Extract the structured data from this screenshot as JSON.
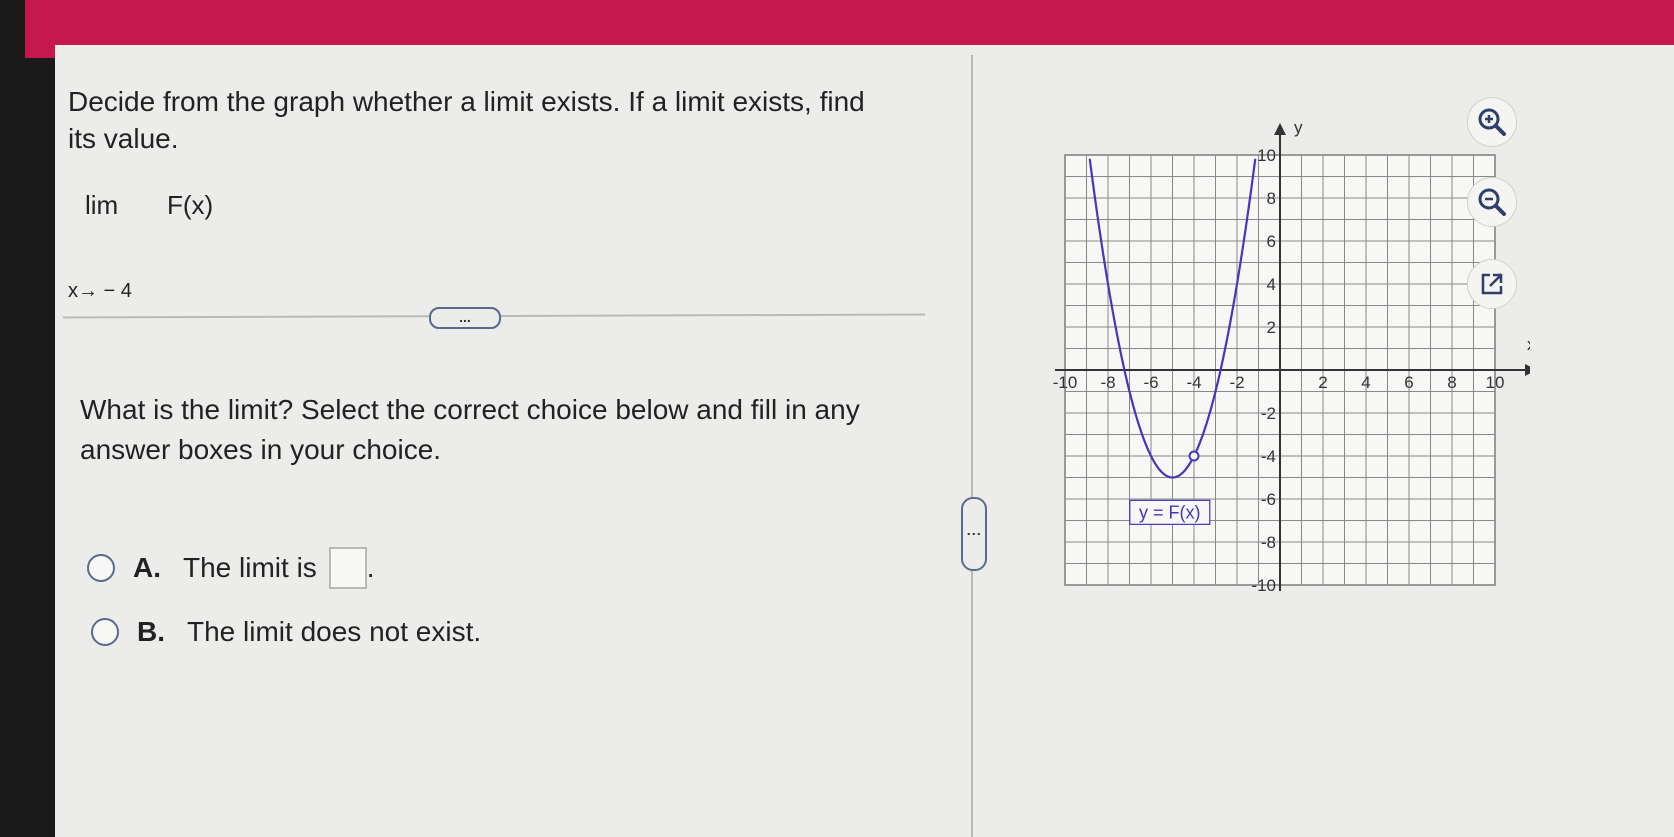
{
  "question": {
    "text": "Decide from the graph whether a limit exists. If a limit exists, find its value."
  },
  "limit": {
    "word": "lim",
    "function": "F(x)",
    "approach": "x→ − 4"
  },
  "more_button_label": "...",
  "prompt": "What is the limit? Select the correct choice below and fill in any answer boxes in your choice.",
  "choices": [
    {
      "letter": "A.",
      "text_before": "The limit is",
      "text_after": ".",
      "selected": false,
      "answer_value": ""
    },
    {
      "letter": "B.",
      "text_before": "The limit does not exist.",
      "text_after": "",
      "selected": false
    }
  ],
  "side_handle_label": "⋮",
  "graph": {
    "x_axis_label": "x",
    "y_axis_label": "y",
    "curve_label": "y = F(x)",
    "x_tick_labels": [
      "-10",
      "-8",
      "-6",
      "-4",
      "-2",
      "2",
      "4",
      "6",
      "8",
      "10"
    ],
    "y_tick_labels": [
      "10",
      "8",
      "6",
      "4",
      "2",
      "-2",
      "-4",
      "-6",
      "-8",
      "-10"
    ],
    "x_range": [
      -10,
      10
    ],
    "y_range": [
      -10,
      10
    ],
    "curve": {
      "function": "F(x) = (x + 5)^2 - 5",
      "color": "#4338b8",
      "open_point": {
        "x": -4,
        "y": -4
      }
    },
    "grid": true
  },
  "toolbar": {
    "zoom_in_icon": "zoom-in-icon",
    "zoom_out_icon": "zoom-out-icon",
    "popout_icon": "popout-icon"
  },
  "colors": {
    "banner": "#c6174f",
    "accent": "#4338b8"
  }
}
